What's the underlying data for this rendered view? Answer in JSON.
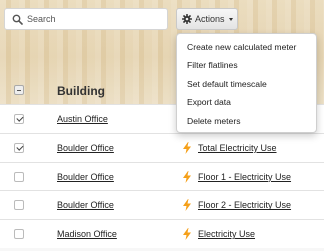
{
  "search": {
    "placeholder": "Search",
    "value": ""
  },
  "actions": {
    "label": "Actions",
    "menu_items": [
      "Create new calculated meter",
      "Filter flatlines",
      "Set default timescale",
      "Export data",
      "Delete meters"
    ]
  },
  "table": {
    "header": {
      "building_label": "Building",
      "master_checkbox_state": "indeterminate"
    },
    "rows": [
      {
        "building": "Austin Office",
        "meter": "",
        "checked": true
      },
      {
        "building": "Boulder Office",
        "meter": "Total Electricity Use",
        "checked": true
      },
      {
        "building": "Boulder Office",
        "meter": "Floor 1 - Electricity Use",
        "checked": false
      },
      {
        "building": "Boulder Office",
        "meter": "Floor 2 - Electricity Use",
        "checked": false
      },
      {
        "building": "Madison Office",
        "meter": "Electricity Use",
        "checked": false
      }
    ]
  },
  "icons": {
    "search": "search-icon",
    "gear": "gear-icon",
    "meter": "lightning-bolt-icon"
  },
  "colors": {
    "header_background": "#e6d5b2",
    "bolt": "#f5a01a"
  }
}
